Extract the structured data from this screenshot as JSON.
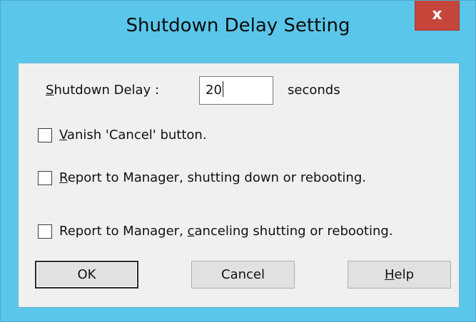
{
  "window": {
    "title": "Shutdown Delay Setting",
    "close_glyph": "x"
  },
  "delay": {
    "label_first": "S",
    "label_rest": "hutdown Delay :",
    "value": "20",
    "unit": "seconds"
  },
  "options": [
    {
      "accel": "V",
      "rest": "anish 'Cancel' button.",
      "checked": false
    },
    {
      "accel": "R",
      "rest": "eport to Manager, shutting down or rebooting.",
      "checked": false
    },
    {
      "before": "Report to Manager, ",
      "accel": "c",
      "rest": "anceling shutting or rebooting.",
      "checked": false
    }
  ],
  "buttons": {
    "ok": "OK",
    "cancel": "Cancel",
    "help_accel": "H",
    "help_rest": "elp"
  },
  "colors": {
    "frame": "#5ac7ea",
    "close_button": "#c7463c",
    "client": "#f0f0f0"
  }
}
